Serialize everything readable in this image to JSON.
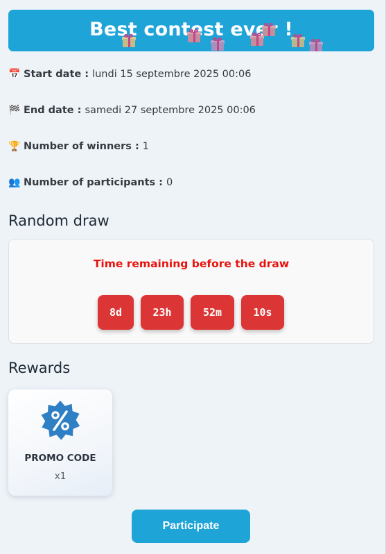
{
  "banner": {
    "title": "Best contest ever !"
  },
  "info": {
    "start": {
      "icon": "calendar-icon",
      "emoji": "📅",
      "label": "Start date :",
      "value": "lundi 15 septembre 2025 00:06"
    },
    "end": {
      "icon": "checkered-flag-icon",
      "emoji": "🏁",
      "label": "End date :",
      "value": "samedi 27 septembre 2025 00:06"
    },
    "winners": {
      "icon": "trophy-icon",
      "emoji": "🏆",
      "label": "Number of winners :",
      "value": "1"
    },
    "participants": {
      "icon": "people-icon",
      "emoji": "👥",
      "label": "Number of participants :",
      "value": "0"
    }
  },
  "draw": {
    "section_title": "Random draw",
    "heading": "Time remaining before the draw",
    "timer": {
      "days": "8d",
      "hours": "23h",
      "minutes": "52m",
      "seconds": "10s"
    }
  },
  "rewards": {
    "section_title": "Rewards",
    "items": [
      {
        "icon": "percent-badge-icon",
        "name": "PROMO CODE",
        "quantity": "x1"
      }
    ]
  },
  "actions": {
    "participate_label": "Participate"
  },
  "colors": {
    "primary": "#1fa4d8",
    "timer": "#dc3535",
    "draw_heading": "#e8120e",
    "badge": "#2f7fc4",
    "background": "#eef3f8"
  }
}
